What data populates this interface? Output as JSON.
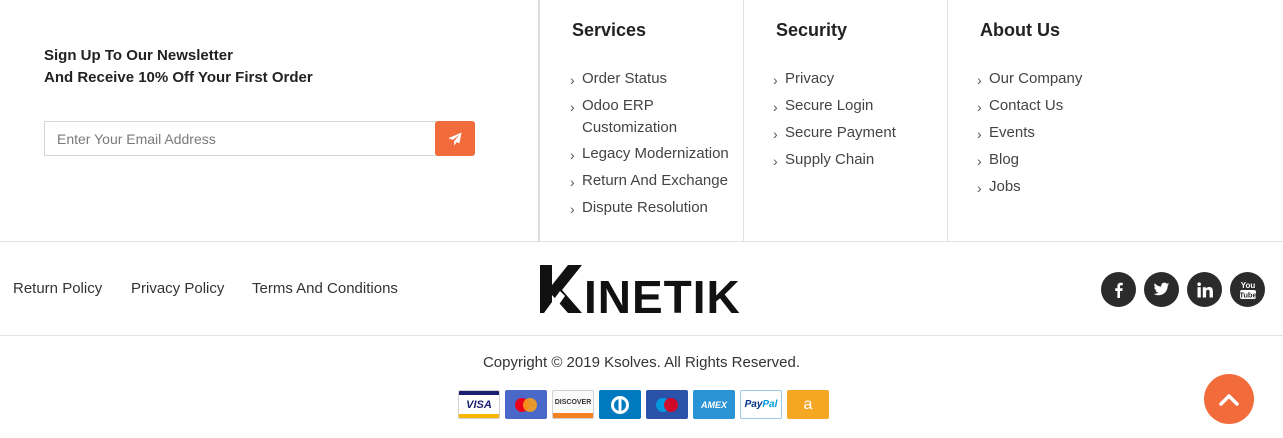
{
  "newsletter": {
    "line1": "Sign Up To Our Newsletter",
    "line2": "And Receive 10% Off Your First Order",
    "placeholder": "Enter Your Email Address",
    "submit_icon": "paper-plane-icon"
  },
  "columns": {
    "services": {
      "title": "Services",
      "items": [
        "Order Status",
        "Odoo ERP Customization",
        "Legacy Modernization",
        "Return And Exchange",
        "Dispute Resolution"
      ]
    },
    "security": {
      "title": "Security",
      "items": [
        "Privacy",
        "Secure Login",
        "Secure Payment",
        "Supply Chain"
      ]
    },
    "about": {
      "title": "About Us",
      "items": [
        "Our Company",
        "Contact Us",
        "Events",
        "Blog",
        "Jobs"
      ]
    }
  },
  "policy_links": [
    "Return Policy",
    "Privacy Policy",
    "Terms And Conditions"
  ],
  "logo_text": "KINETIK",
  "social": [
    "facebook-icon",
    "twitter-icon",
    "linkedin-icon",
    "youtube-icon"
  ],
  "copyright": "Copyright © 2019 Ksolves. All Rights Reserved.",
  "payment_cards": [
    {
      "name": "VISA",
      "icon": "visa-icon"
    },
    {
      "name": "mastercard",
      "icon": "mastercard-icon"
    },
    {
      "name": "DISCOVER",
      "icon": "discover-icon"
    },
    {
      "name": "diners",
      "icon": "diners-club-icon"
    },
    {
      "name": "maestro",
      "icon": "maestro-icon"
    },
    {
      "name": "AMEX",
      "icon": "amex-icon"
    },
    {
      "name": "PayPal",
      "icon": "paypal-icon"
    },
    {
      "name": "a",
      "icon": "amazon-icon"
    }
  ],
  "colors": {
    "accent": "#f26b3a",
    "social_bg": "#2b2b2b",
    "text": "#333333"
  },
  "scroll_top_icon": "chevron-up-icon"
}
